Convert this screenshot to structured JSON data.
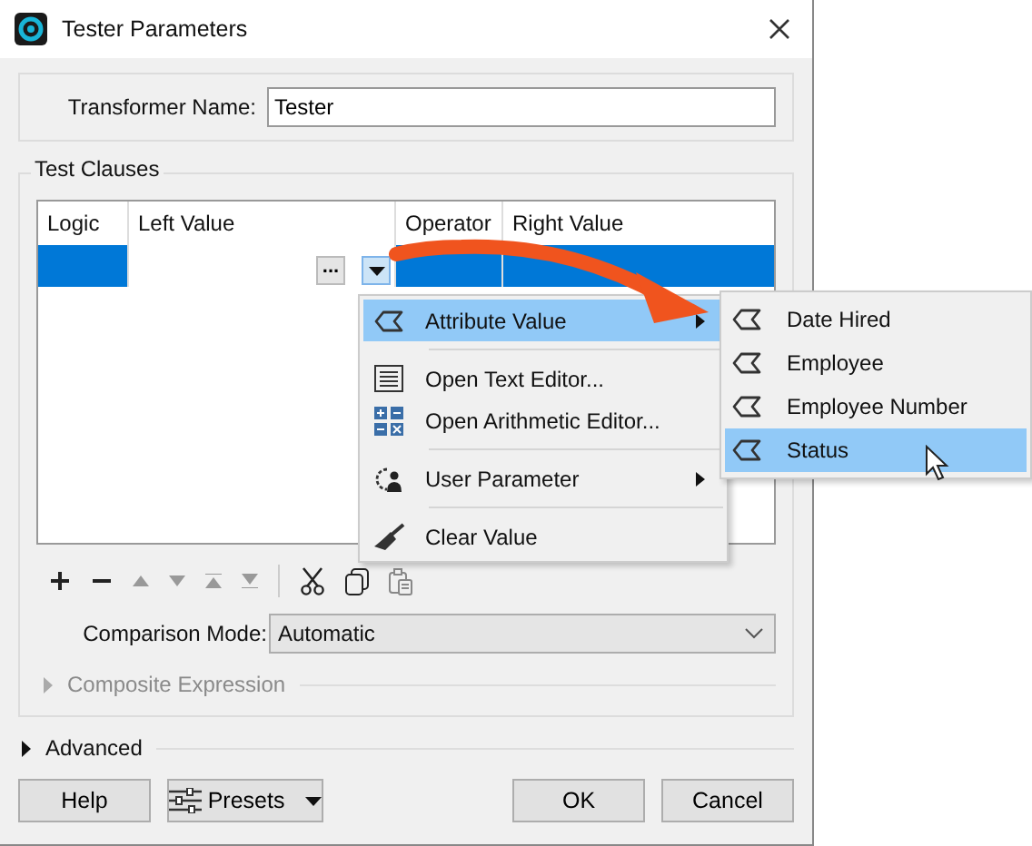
{
  "window": {
    "title": "Tester Parameters"
  },
  "transformer_name": {
    "label": "Transformer Name:",
    "value": "Tester"
  },
  "test_clauses": {
    "title": "Test Clauses",
    "columns": [
      "Logic",
      "Left Value",
      "Operator",
      "Right Value"
    ],
    "rows": [
      {
        "selected": true,
        "ellipsis": "..."
      }
    ]
  },
  "context_menu": {
    "sections": [
      [
        {
          "label": "Attribute Value",
          "kind": "attribute",
          "submenu": true,
          "selected": true
        }
      ],
      [
        {
          "label": "Open Text Editor...",
          "kind": "text-editor",
          "submenu": false,
          "selected": false
        },
        {
          "label": "Open Arithmetic Editor...",
          "kind": "arithmetic",
          "submenu": false,
          "selected": false
        }
      ],
      [
        {
          "label": "User Parameter",
          "kind": "user-parameter",
          "submenu": true,
          "selected": false
        }
      ],
      [
        {
          "label": "Clear Value",
          "kind": "clear",
          "submenu": false,
          "selected": false
        }
      ]
    ]
  },
  "submenu": {
    "items": [
      {
        "label": "Date Hired",
        "selected": false
      },
      {
        "label": "Employee",
        "selected": false
      },
      {
        "label": "Employee Number",
        "selected": false
      },
      {
        "label": "Status",
        "selected": true
      }
    ]
  },
  "comparison_mode": {
    "label": "Comparison Mode:",
    "value": "Automatic"
  },
  "composite_expression": {
    "label": "Composite Expression",
    "disabled": true,
    "expanded": false
  },
  "advanced": {
    "label": "Advanced",
    "expanded": false
  },
  "buttons": {
    "left": [
      {
        "label": "Help",
        "kind": "plain"
      },
      {
        "label": "Presets",
        "kind": "presets"
      }
    ],
    "right": [
      {
        "label": "OK"
      },
      {
        "label": "Cancel"
      }
    ]
  }
}
